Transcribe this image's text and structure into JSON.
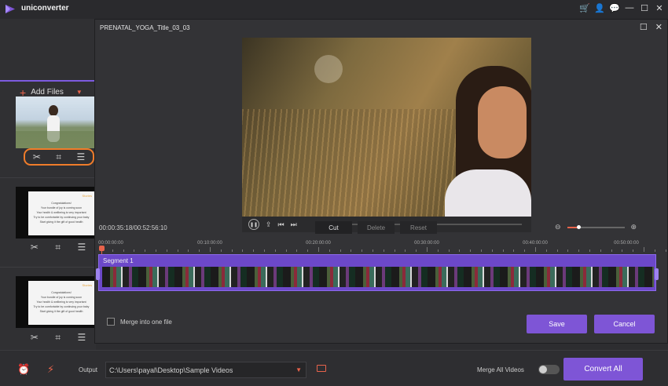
{
  "app": {
    "name": "uniconverter"
  },
  "window_controls": [
    "cart-icon",
    "user-icon",
    "chat-icon",
    "minimize-icon",
    "maximize-icon",
    "close-icon"
  ],
  "left_panel": {
    "add_files_label": "Add Files",
    "thumb_text": {
      "tag": "Stories",
      "lines": [
        "Congratulations!",
        "Your bundle of joy is coming soon",
        "Your health & wellbeing is very important",
        "Try to be comfortable by continuing your baby",
        "Start giving it the gift of good health"
      ]
    }
  },
  "editor": {
    "title": "PRENATAL_YOGA_Title_03_03",
    "time_readout": "00:00:35:18/00:52:56:10",
    "actions": {
      "cut": "Cut",
      "delete": "Delete",
      "reset": "Reset"
    },
    "playback_progress": 0.02,
    "zoom_level": 0.2,
    "ruler_labels": [
      "00:00:00:00",
      "00:10:00:00",
      "00:20:00:00",
      "00:30:00:00",
      "00:40:00:00",
      "00:50:00:00"
    ],
    "segment_label": "Segment 1",
    "merge_label": "Merge into one file",
    "save_label": "Save",
    "cancel_label": "Cancel"
  },
  "bottom": {
    "output_label": "Output",
    "output_path": "C:\\Users\\payal\\Desktop\\Sample Videos",
    "merge_all_label": "Merge All Videos",
    "merge_all_enabled": false,
    "convert_all_label": "Convert All"
  },
  "colors": {
    "accent": "#7e55d6",
    "highlight": "#f07c2a",
    "warn": "#e8634b"
  }
}
